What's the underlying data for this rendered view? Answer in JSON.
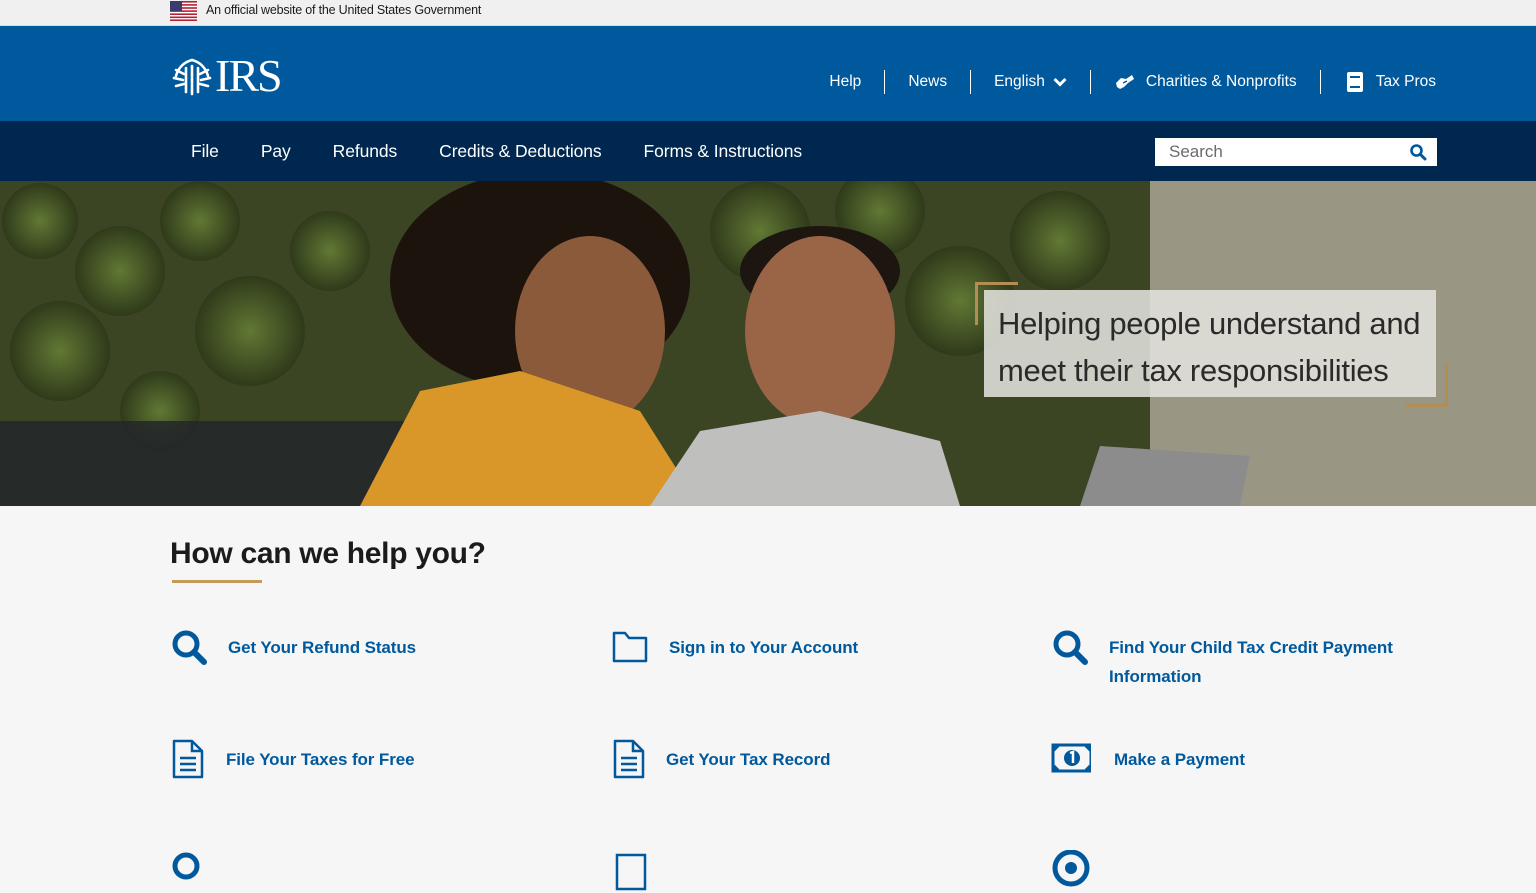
{
  "gov_banner": {
    "text": "An official website of the United States Government",
    "flag_icon": "us-flag-icon"
  },
  "header": {
    "logo_text": "IRS",
    "logo_icon": "irs-eagle-logo-icon",
    "utility_nav": [
      {
        "label": "Help",
        "icon": null
      },
      {
        "label": "News",
        "icon": null
      },
      {
        "label": "English",
        "icon": "chevron-down-icon"
      },
      {
        "label": "Charities & Nonprofits",
        "icon": "handshake-icon"
      },
      {
        "label": "Tax Pros",
        "icon": "book-icon"
      }
    ]
  },
  "main_nav": {
    "items": [
      "File",
      "Pay",
      "Refunds",
      "Credits & Deductions",
      "Forms & Instructions"
    ]
  },
  "search": {
    "placeholder": "Search",
    "icon": "search-icon"
  },
  "hero": {
    "tagline": "Helping people understand and meet their tax responsibilities"
  },
  "help": {
    "title": "How can we help you?",
    "tasks": [
      {
        "label": "Get Your Refund Status",
        "icon": "magnifier-icon"
      },
      {
        "label": "Sign in to Your Account",
        "icon": "folder-icon"
      },
      {
        "label": "Find Your Child Tax Credit Payment Information",
        "icon": "magnifier-icon"
      },
      {
        "label": "File Your Taxes for Free",
        "icon": "document-icon"
      },
      {
        "label": "Get Your Tax Record",
        "icon": "document-icon"
      },
      {
        "label": "Make a Payment",
        "icon": "money-icon"
      }
    ]
  },
  "colors": {
    "header_blue": "#00599c",
    "nav_navy": "#00274f",
    "link_blue": "#00599c",
    "accent_gold": "#b28e55"
  }
}
